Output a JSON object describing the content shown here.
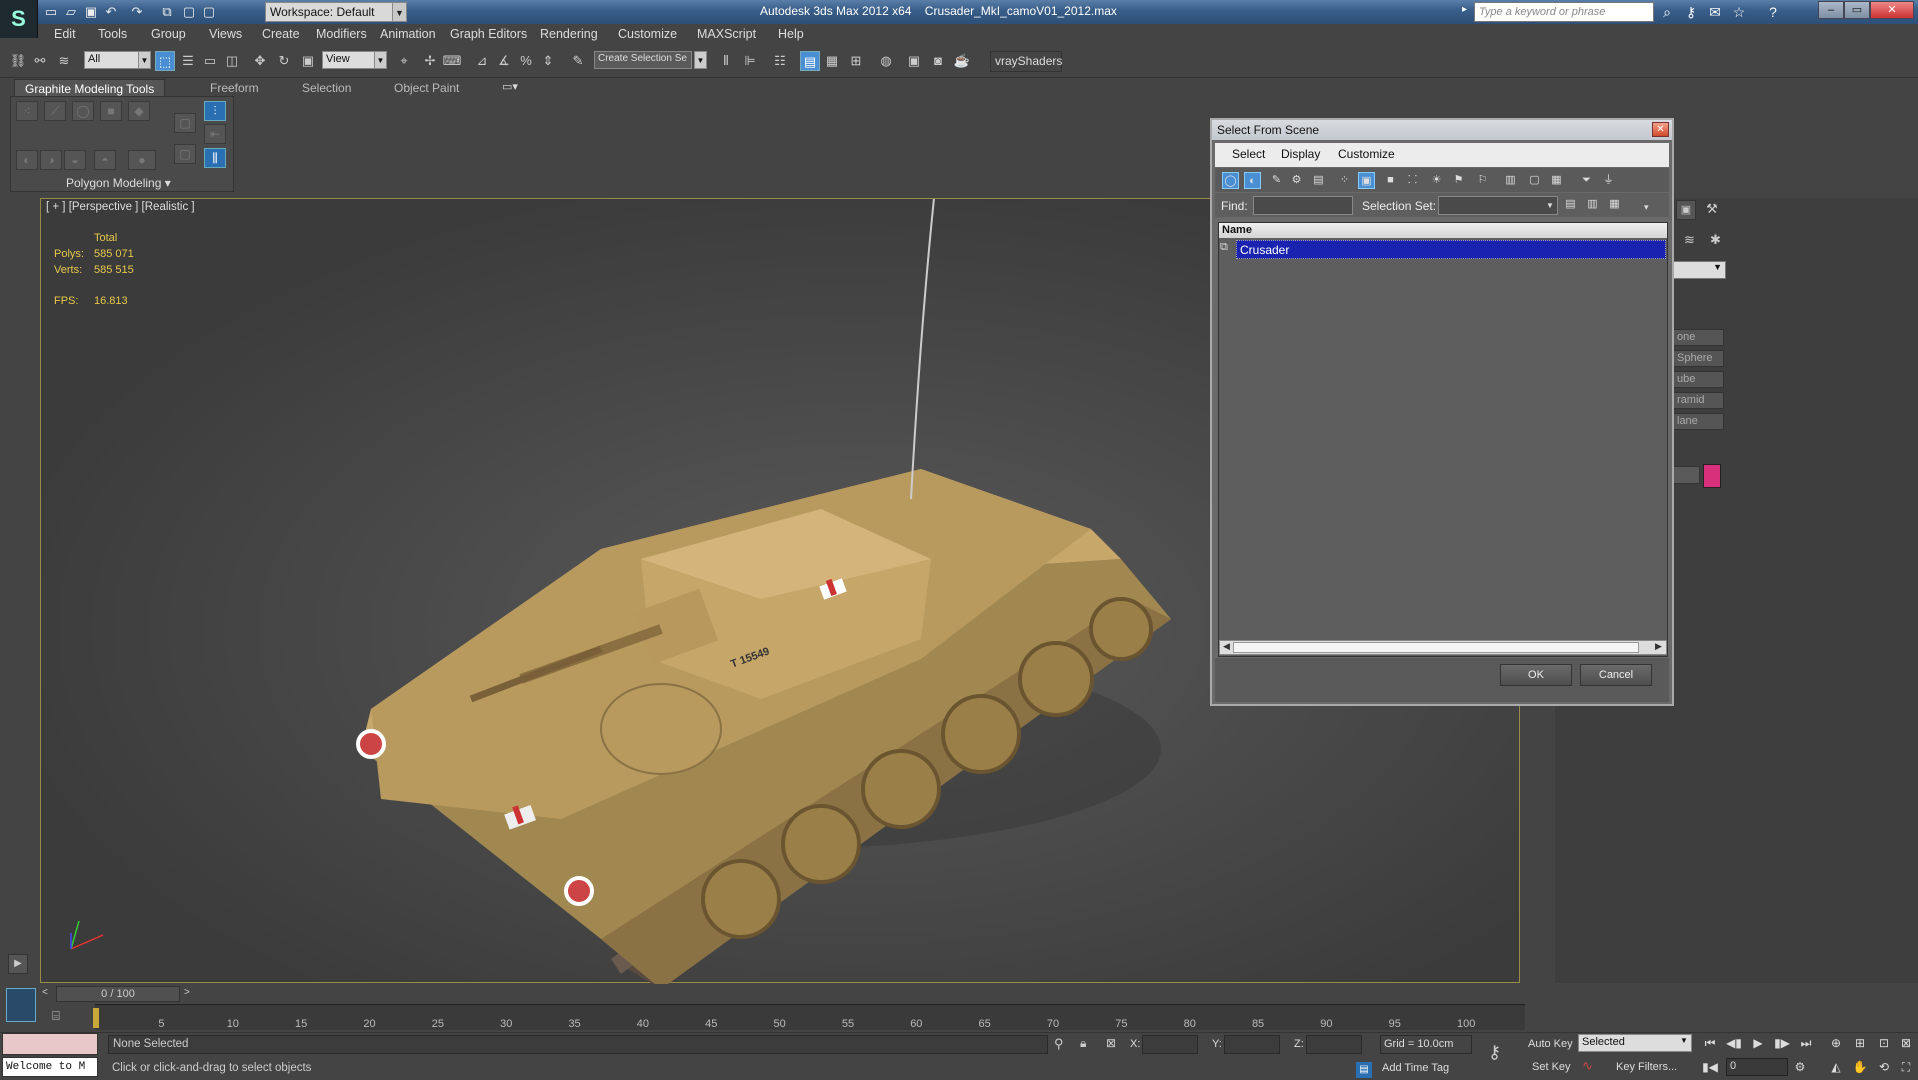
{
  "window": {
    "app_title": "Autodesk 3ds Max  2012 x64",
    "file_name": "Crusader_MkI_camoV01_2012.max",
    "workspace": "Workspace: Default",
    "search_placeholder": "Type a keyword or phrase"
  },
  "menubar": [
    "Edit",
    "Tools",
    "Group",
    "Views",
    "Create",
    "Modifiers",
    "Animation",
    "Graph Editors",
    "Rendering",
    "Customize",
    "MAXScript",
    "Help"
  ],
  "toolbar": {
    "filter_value": "All",
    "refcoord_value": "View",
    "selection_set_placeholder": "Create Selection Se",
    "vray_label": "vrayShaders"
  },
  "ribbon": {
    "tabs": [
      "Graphite Modeling Tools",
      "Freeform",
      "Selection",
      "Object Paint"
    ],
    "panel_label": "Polygon Modeling"
  },
  "viewport": {
    "label": "[ + ] [Perspective ] [Realistic ]",
    "stats_header": "Total",
    "polys_label": "Polys:",
    "polys_value": "585 071",
    "verts_label": "Verts:",
    "verts_value": "585 515",
    "fps_label": "FPS:",
    "fps_value": "16.813",
    "tank_marking": "T 15549"
  },
  "command_panel": {
    "buttons": [
      "one",
      "Sphere",
      "ube",
      "ramid",
      "lane"
    ],
    "swatch_color": "#d8307a"
  },
  "dialog": {
    "title": "Select From Scene",
    "menu": [
      "Select",
      "Display",
      "Customize"
    ],
    "find_label": "Find:",
    "selection_set_label": "Selection Set:",
    "column_name": "Name",
    "rows": [
      "Crusader"
    ],
    "ok": "OK",
    "cancel": "Cancel"
  },
  "timeline": {
    "frame_counter": "0 / 100",
    "ticks": [
      "5",
      "10",
      "15",
      "20",
      "25",
      "30",
      "35",
      "40",
      "45",
      "50",
      "55",
      "60",
      "65",
      "70",
      "75",
      "80",
      "85",
      "90",
      "95",
      "100"
    ]
  },
  "status": {
    "listener": "Welcome to M",
    "selection": "None Selected",
    "prompt": "Click or click-and-drag to select objects",
    "x_label": "X:",
    "y_label": "Y:",
    "z_label": "Z:",
    "grid": "Grid = 10.0cm",
    "add_time_tag": "Add Time Tag",
    "auto_key": "Auto Key",
    "set_key": "Set Key",
    "key_mode": "Selected",
    "key_filters": "Key Filters...",
    "frame_value": "0"
  }
}
